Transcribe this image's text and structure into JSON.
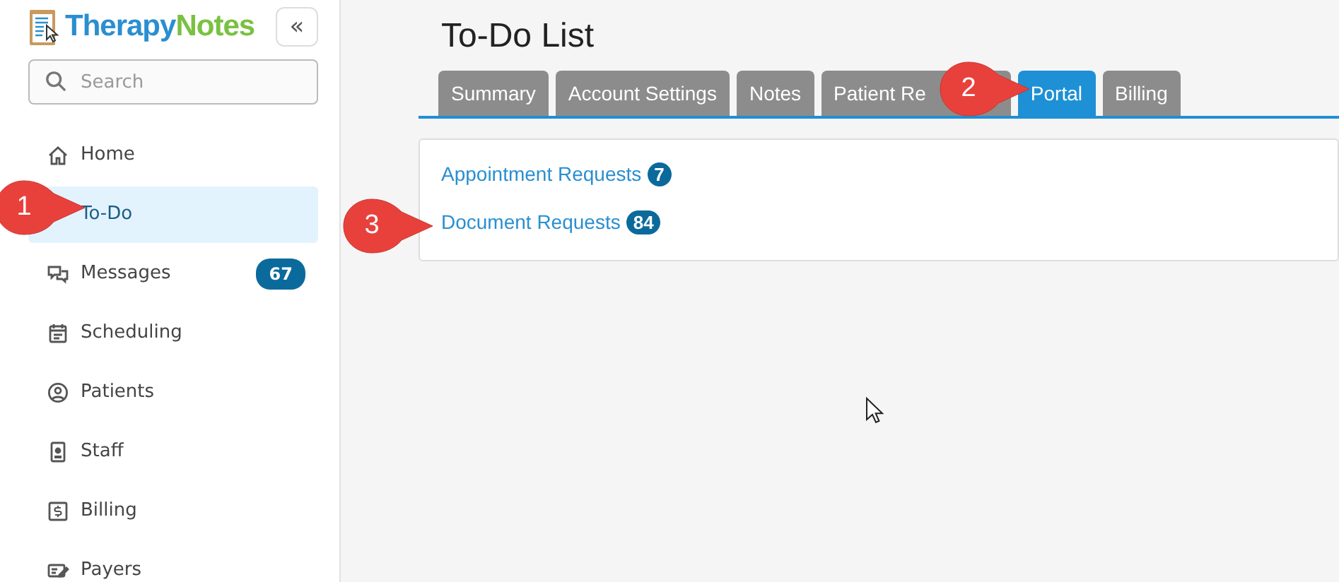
{
  "sidebar": {
    "logo": {
      "text_1": "Therapy",
      "text_2": "Notes"
    },
    "collapse_button": "«",
    "search": {
      "placeholder": "Search"
    },
    "items": [
      {
        "label": "Home",
        "selected": false
      },
      {
        "label": "To-Do",
        "selected": true
      },
      {
        "label": "Messages",
        "selected": false,
        "badge": "67"
      },
      {
        "label": "Scheduling",
        "selected": false
      },
      {
        "label": "Patients",
        "selected": false
      },
      {
        "label": "Staff",
        "selected": false
      },
      {
        "label": "Billing",
        "selected": false
      },
      {
        "label": "Payers",
        "selected": false
      }
    ]
  },
  "page": {
    "title": "To-Do List",
    "tabs": [
      {
        "label": "Summary",
        "selected": false
      },
      {
        "label": "Account Settings",
        "selected": false
      },
      {
        "label": "Notes",
        "selected": false
      },
      {
        "label": "Patient Re",
        "selected": false
      },
      {
        "label": "Portal",
        "selected": true
      },
      {
        "label": "Billing",
        "selected": false
      }
    ],
    "requests": [
      {
        "label": "Appointment Requests",
        "count": "7"
      },
      {
        "label": "Document Requests",
        "count": "84"
      }
    ]
  },
  "callouts": [
    "1",
    "2",
    "3"
  ]
}
